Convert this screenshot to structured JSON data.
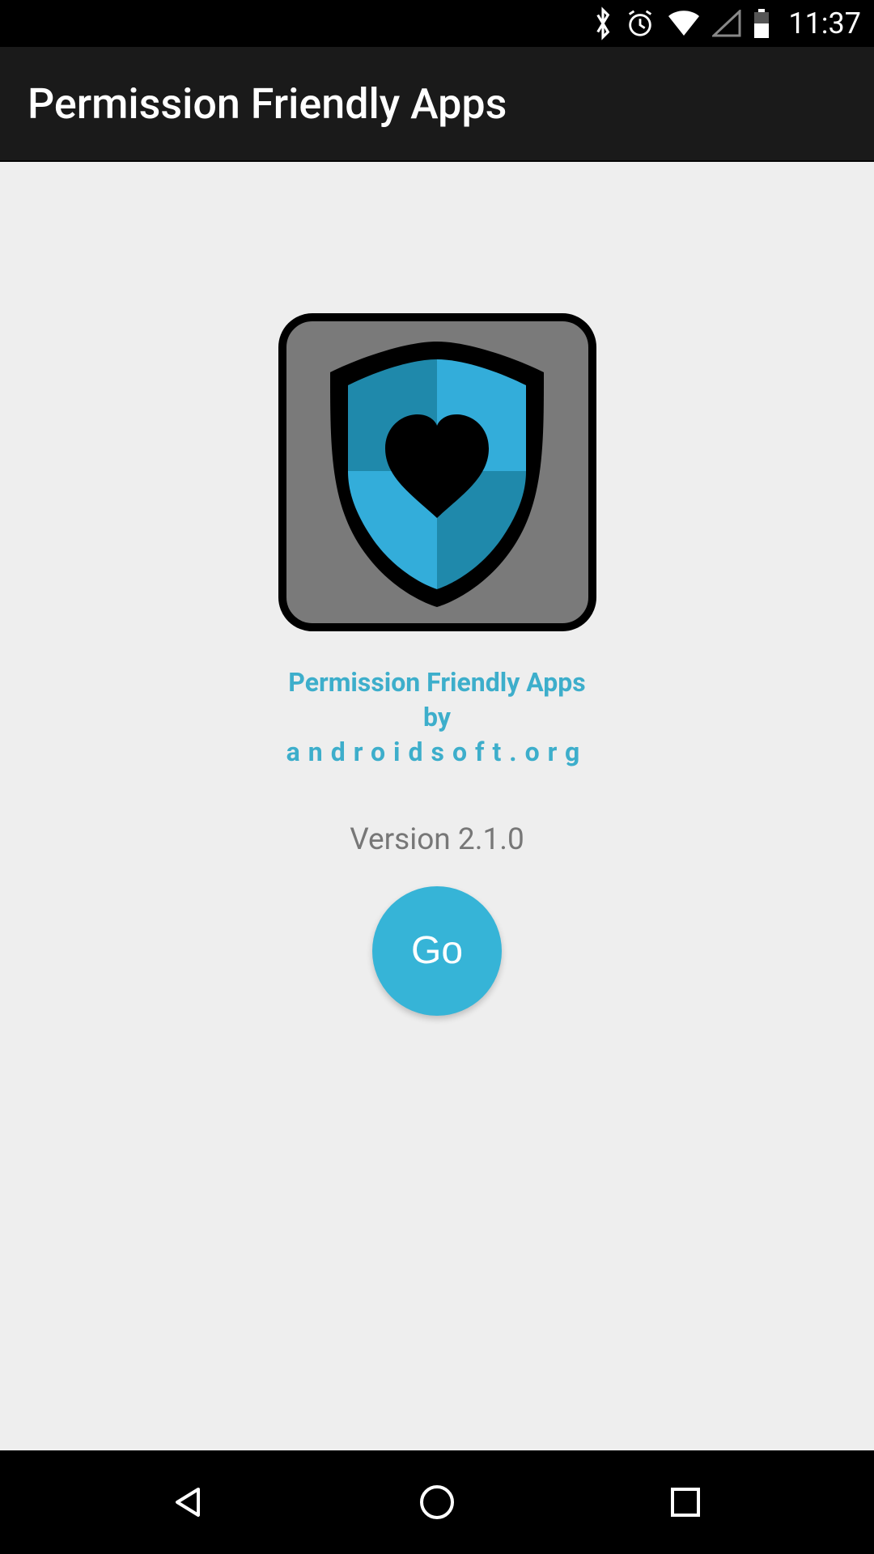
{
  "statusBar": {
    "time": "11:37"
  },
  "appBar": {
    "title": "Permission Friendly Apps"
  },
  "splash": {
    "line1": "Permission Friendly Apps",
    "line2": "by",
    "line3": "androidsoft.org",
    "version": "Version 2.1.0",
    "goLabel": "Go"
  },
  "colors": {
    "accent": "#36b4d7",
    "shieldDark": "#1f89ab",
    "shieldLight": "#33adda"
  }
}
